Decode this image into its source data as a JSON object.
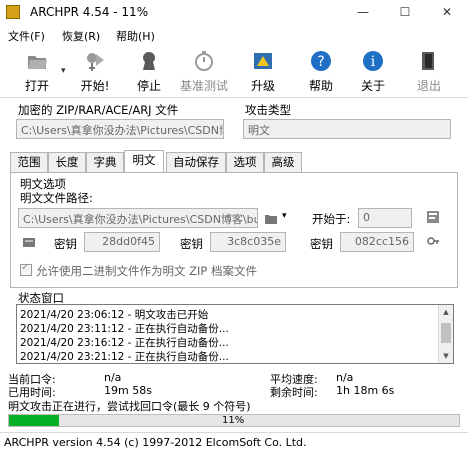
{
  "window": {
    "title": "ARCHPR 4.54 - 11%",
    "minimize_icon": "minimize-icon",
    "maximize_icon": "maximize-icon",
    "close_icon": "close-icon",
    "minimize_glyph": "—",
    "maximize_glyph": "☐",
    "close_glyph": "✕"
  },
  "menu": [
    "文件(F)",
    "恢复(R)",
    "帮助(H)"
  ],
  "toolbar": {
    "open": "打开",
    "start": "开始!",
    "stop": "停止",
    "benchmark": "基准测试",
    "upgrade": "升级",
    "help": "帮助",
    "about": "关于",
    "exit": "退出"
  },
  "encrypted_file": {
    "label": "加密的 ZIP/RAR/ACE/ARJ 文件",
    "value": "C:\\Users\\真拿你没办法\\Pictures\\CSDN博"
  },
  "attack_type": {
    "label": "攻击类型",
    "value": "明文"
  },
  "tabs": [
    "范围",
    "长度",
    "字典",
    "明文",
    "自动保存",
    "选项",
    "高级"
  ],
  "active_tab": 3,
  "plaintext": {
    "section_label": "明文选项",
    "path_label": "明文文件路径:",
    "path_value": "C:\\Users\\真拿你没办法\\Pictures\\CSDN博客\\bu",
    "start_at_label": "开始于:",
    "start_at_value": "0",
    "key_label": "密钥",
    "key1": "28dd0f45",
    "key2": "3c8c035e",
    "key3": "082cc156",
    "checkbox_label": "允许使用二进制文件作为明文 ZIP 档案文件",
    "checkbox_checked": true
  },
  "status": {
    "label": "状态窗口",
    "lines": [
      "2021/4/20 23:06:12 - 明文攻击已开始",
      "2021/4/20 23:11:12 - 正在执行自动备份...",
      "2021/4/20 23:16:12 - 正在执行自动备份...",
      "2021/4/20 23:21:12 - 正在执行自动备份..."
    ]
  },
  "stats": {
    "current_password_label": "当前口令:",
    "current_password": "n/a",
    "avg_speed_label": "平均速度:",
    "avg_speed": "n/a",
    "elapsed_label": "已用时间:",
    "elapsed": "19m 58s",
    "remaining_label": "剩余时间:",
    "remaining": "1h 18m 6s",
    "message": "明文攻击正在进行，尝试找回口令(最长 9 个符号)"
  },
  "progress": {
    "value": 0.11,
    "label": "11%"
  },
  "footer": "ARCHPR version 4.54 (c) 1997-2012 ElcomSoft Co. Ltd.",
  "colors": {
    "progress_fill": "#06b025",
    "icon_blue": "#1f6fc5"
  }
}
